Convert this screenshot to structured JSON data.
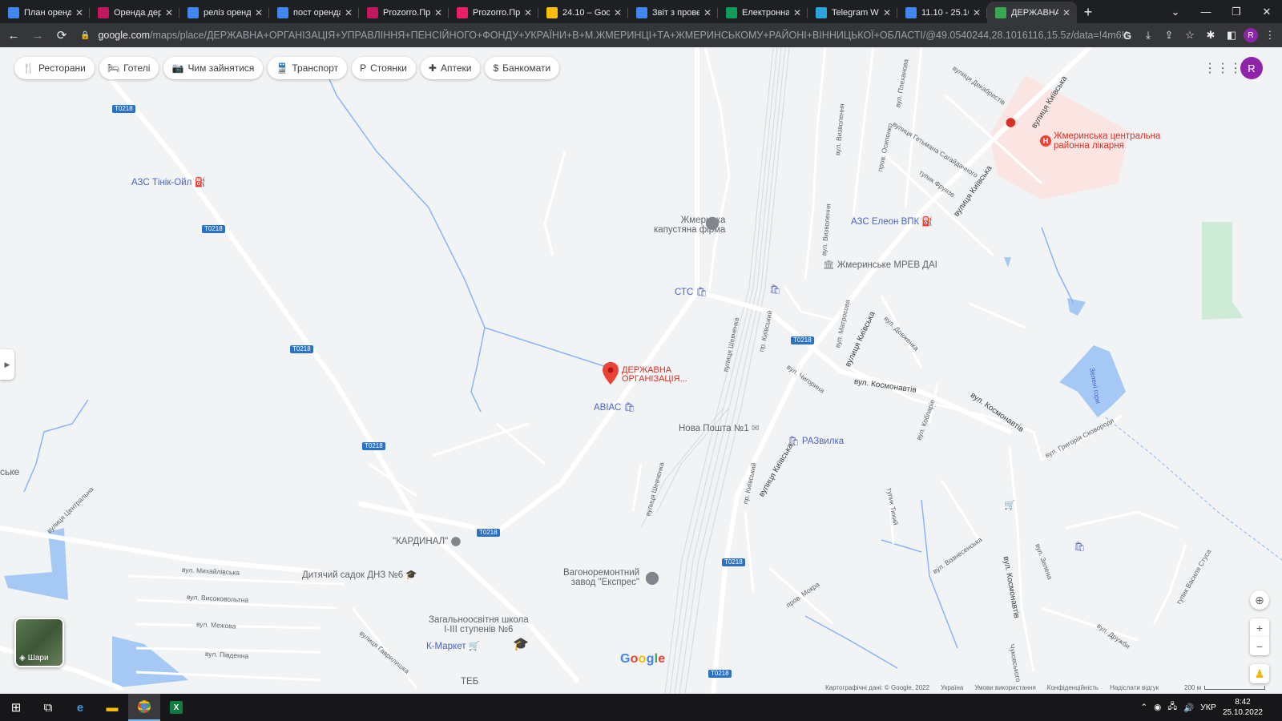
{
  "browser": {
    "tabs": [
      {
        "title": "План оренди",
        "icon": "docs-icon",
        "color": "#4285f4"
      },
      {
        "title": "Оренда держ",
        "icon": "prozorro-icon",
        "color": "#c2185b"
      },
      {
        "title": "реліз оренда",
        "icon": "docs-icon",
        "color": "#4285f4"
      },
      {
        "title": "пост оренда",
        "icon": "docs-icon",
        "color": "#4285f4"
      },
      {
        "title": "Prozorro.Про",
        "icon": "prozorro-icon",
        "color": "#c2185b"
      },
      {
        "title": "Prozorro.Про",
        "icon": "prozorro-square-icon",
        "color": "#e91e63"
      },
      {
        "title": "24.10 – Goog",
        "icon": "drive-icon",
        "color": "#fbbc04"
      },
      {
        "title": "Звіт з провед",
        "icon": "docs-icon",
        "color": "#4285f4"
      },
      {
        "title": "Електронна т",
        "icon": "sheets-icon",
        "color": "#0f9d58"
      },
      {
        "title": "Telegram Wel",
        "icon": "telegram-icon",
        "color": "#2aa3df"
      },
      {
        "title": "11.10 - 25.10",
        "icon": "docs-icon",
        "color": "#4285f4"
      },
      {
        "title": "ДЕРЖАВНА С",
        "icon": "maps-icon",
        "color": "#34a853"
      }
    ],
    "url_host": "google.com",
    "url_path": "/maps/place/ДЕРЖАВНА+ОРГАНІЗАЦІЯ+УПРАВЛІННЯ+ПЕНСІЙНОГО+ФОНДУ+УКРАЇНИ+В+М.ЖМЕРИНЦІ+ТА+ЖМЕРИНСЬКОМУ+РАЙОНІ+ВІННИЦЬКОЇ+ОБЛАСТІ/@49.0540244,28.1016116,15.5z/data=!4m6!3m5!1s0x4732...",
    "profile_letter": "R"
  },
  "map": {
    "chips": [
      {
        "label": "Ресторани",
        "icon": "restaurant-icon",
        "glyph": "🍴"
      },
      {
        "label": "Готелі",
        "icon": "hotel-icon",
        "glyph": "🛏"
      },
      {
        "label": "Чим зайнятися",
        "icon": "camera-icon",
        "glyph": "📷"
      },
      {
        "label": "Транспорт",
        "icon": "transit-icon",
        "glyph": "🚆"
      },
      {
        "label": "Стоянки",
        "icon": "parking-icon",
        "glyph": "P"
      },
      {
        "label": "Аптеки",
        "icon": "pharmacy-icon",
        "glyph": "✚"
      },
      {
        "label": "Банкомати",
        "icon": "atm-icon",
        "glyph": "$"
      }
    ],
    "account_letter": "R",
    "selected_place": "ДЕРЖАВНА ОРГАНІЗАЦІЯ...",
    "selected_place_line1": "ДЕРЖАВНА",
    "selected_place_line2": "ОРГАНІЗАЦІЯ...",
    "places": {
      "azs_tinik": "АЗС Тінік-Ойл",
      "kapusta": "Жмеринка капустяна фірма",
      "kapusta_l1": "Жмеринка",
      "kapusta_l2": "капустяна фірма",
      "sts": "СТС",
      "azs_eleon": "АЗС Елеон ВПК",
      "mrev": "Жмеринське МРЕВ ДАІ",
      "hospital_l1": "Жмеринська центральна",
      "hospital_l2": "районна лікарня",
      "avias": "АВІАС",
      "nova_poshta": "Нова Пошта №1",
      "razvilka": "РАЗвилка",
      "kardinal": "\"КАРДИНАЛ\"",
      "dnz6": "Дитячий садок ДНЗ №6",
      "vagon_l1": "Вагоноремонтний",
      "vagon_l2": "завод \"Експрес\"",
      "school_l1": "Загальноосвітня школа",
      "school_l2": "I-III ступенів №6",
      "kmarket": "К-Маркет",
      "place_cut": "ське",
      "place_teb": "ТЕБ"
    },
    "streets": {
      "kyivska": "вулиця Київська",
      "kosmonavtiv": "вул. Космонавтів",
      "kosmonavtiv2": "вул. Космонавтів",
      "kosmonavtiv3": "вул. Космонавтів",
      "dekabristiv": "вулиця Декабристів",
      "plekhanova": "вул. Плеханова",
      "sahaidachnoho": "вулиця Гетьмана Сагайдачного",
      "osypenko": "пров. Осипенко",
      "frunze": "тупик Фрунзе",
      "vyzvolennia": "вул. Визволення",
      "matrosova": "вул. Матросова",
      "dovzhenka": "вул. Довженка",
      "chyhoryna": "вул. Чигорина",
      "kyivskyi": "пр. Київський",
      "shevchenka": "вулиця Шевченка",
      "koblarie": "вул. Кобларіе",
      "skovorody": "вул. Григорія Сковороди",
      "tykha": "тупик Тихий",
      "voznesenska": "вул. Вознесенська",
      "zelena": "вул. Зелена",
      "stusa": "тупик Василя Стуса",
      "druzhby": "вул. Дружби",
      "mokra": "пров. Мокра",
      "tsentralna": "вулиця Центральна",
      "mykhailivska": "вул. Михайлівська",
      "vysokovoltna": "вул. Високовольтна",
      "mezhova": "вул. Межова",
      "pivdenna": "вул. Південна",
      "havrylyshka": "вулиця Гаврилишка",
      "zeleni_hory": "Зелені гори",
      "chukovskoho": "Чуковського"
    },
    "road_code": "Т0218",
    "layers_label": "Шари",
    "google": "Google",
    "attribution": [
      "Картографічні дані: © Google, 2022",
      "Україна",
      "Умови використання",
      "Конфіденційність",
      "Надіслати відгук"
    ],
    "scale": "200 м"
  },
  "taskbar": {
    "lang": "УКР",
    "time": "8:42",
    "date": "25.10.2022"
  }
}
